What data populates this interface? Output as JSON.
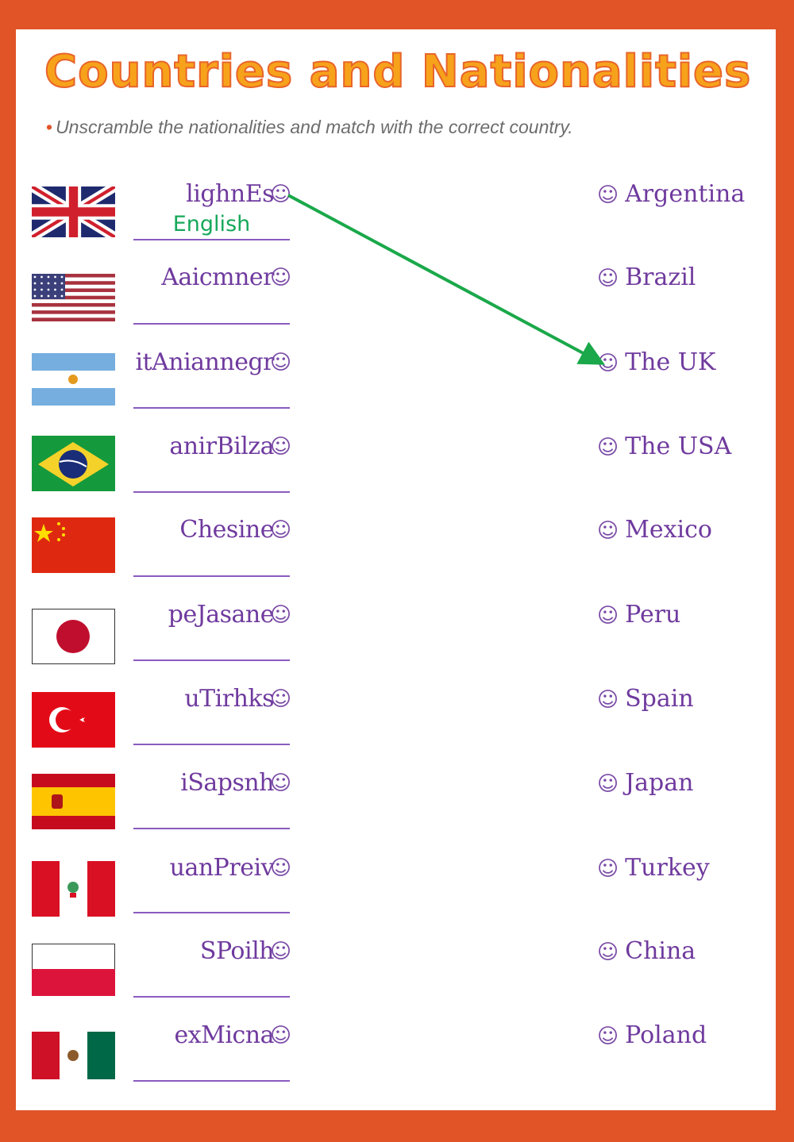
{
  "title": "Countries and Nationalities",
  "instruction": "Unscramble the nationalities and match with the correct country.",
  "colors": {
    "border": "#e05428",
    "title_fill": "#f7a21b",
    "text_purple": "#6f3a9e",
    "answer_green": "#17a85a",
    "arrow_green": "#1aa84a"
  },
  "smiley_icon": "☺",
  "nationalities": [
    {
      "flag": "uk-flag",
      "scrambled": "lighnEs",
      "answer": "English"
    },
    {
      "flag": "usa-flag",
      "scrambled": "Aaicmner",
      "answer": ""
    },
    {
      "flag": "argentina-flag",
      "scrambled": "itAniannegr",
      "answer": ""
    },
    {
      "flag": "brazil-flag",
      "scrambled": "anirBilza",
      "answer": ""
    },
    {
      "flag": "china-flag",
      "scrambled": "Chesine",
      "answer": ""
    },
    {
      "flag": "japan-flag",
      "scrambled": "peJasane",
      "answer": ""
    },
    {
      "flag": "turkey-flag",
      "scrambled": "uTirhks",
      "answer": ""
    },
    {
      "flag": "spain-flag",
      "scrambled": "iSapsnh",
      "answer": ""
    },
    {
      "flag": "peru-flag",
      "scrambled": "uanPreiv",
      "answer": ""
    },
    {
      "flag": "poland-flag",
      "scrambled": "SPoilh",
      "answer": ""
    },
    {
      "flag": "mexico-flag",
      "scrambled": "exMicna",
      "answer": ""
    }
  ],
  "countries": [
    {
      "label": "Argentina"
    },
    {
      "label": "Brazil"
    },
    {
      "label": "The UK"
    },
    {
      "label": "The USA"
    },
    {
      "label": "Mexico"
    },
    {
      "label": "Peru"
    },
    {
      "label": "Spain"
    },
    {
      "label": "Japan"
    },
    {
      "label": "Turkey"
    },
    {
      "label": "China"
    },
    {
      "label": "Poland"
    }
  ],
  "matches": [
    {
      "from": "lighnEs",
      "to": "The UK"
    }
  ]
}
